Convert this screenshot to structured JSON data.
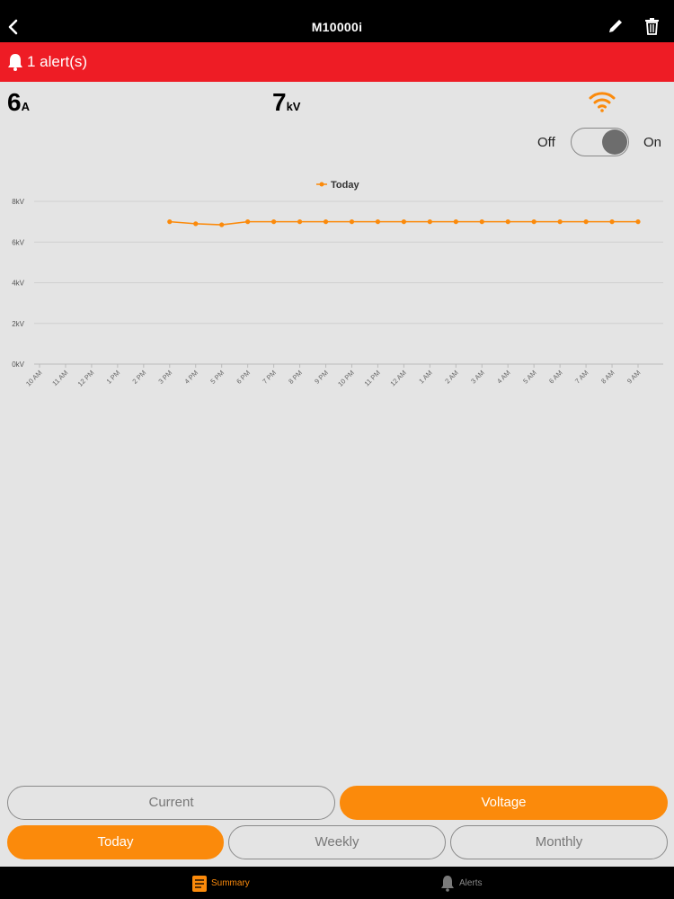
{
  "header": {
    "title": "M10000i"
  },
  "alert": {
    "text": "1 alert(s)"
  },
  "readings": {
    "current": {
      "value": "6",
      "unit": "A"
    },
    "voltage": {
      "value": "7",
      "unit": "kV"
    }
  },
  "power_toggle": {
    "off_label": "Off",
    "on_label": "On",
    "state": "on"
  },
  "colors": {
    "accent": "#fb8a0b",
    "alert": "#ee1c25",
    "bar": "#000000",
    "background": "#e4e4e4"
  },
  "chart_data": {
    "type": "line",
    "legend": "Today",
    "legend_position": "top-center",
    "y_ticks": [
      "0kV",
      "2kV",
      "4kV",
      "6kV",
      "8kV"
    ],
    "ylim": [
      0,
      8
    ],
    "grid": true,
    "categories": [
      "10 AM",
      "11 AM",
      "12 PM",
      "1 PM",
      "2 PM",
      "3 PM",
      "4 PM",
      "5 PM",
      "6 PM",
      "7 PM",
      "8 PM",
      "9 PM",
      "10 PM",
      "11 PM",
      "12 AM",
      "1 AM",
      "2 AM",
      "3 AM",
      "4 AM",
      "5 AM",
      "6 AM",
      "7 AM",
      "8 AM",
      "9 AM"
    ],
    "series": [
      {
        "name": "Today",
        "values": [
          null,
          null,
          null,
          null,
          null,
          7.0,
          6.9,
          6.85,
          7.0,
          7.0,
          7.0,
          7.0,
          7.0,
          7.0,
          7.0,
          7.0,
          7.0,
          7.0,
          7.0,
          7.0,
          7.0,
          7.0,
          7.0,
          7.0
        ]
      }
    ]
  },
  "segments": {
    "metric": [
      {
        "label": "Current",
        "active": false
      },
      {
        "label": "Voltage",
        "active": true
      }
    ],
    "period": [
      {
        "label": "Today",
        "active": true
      },
      {
        "label": "Weekly",
        "active": false
      },
      {
        "label": "Monthly",
        "active": false
      }
    ]
  },
  "tabs": [
    {
      "label": "Summary",
      "icon": "summary-icon",
      "active": true
    },
    {
      "label": "Alerts",
      "icon": "bell-icon",
      "active": false
    }
  ]
}
